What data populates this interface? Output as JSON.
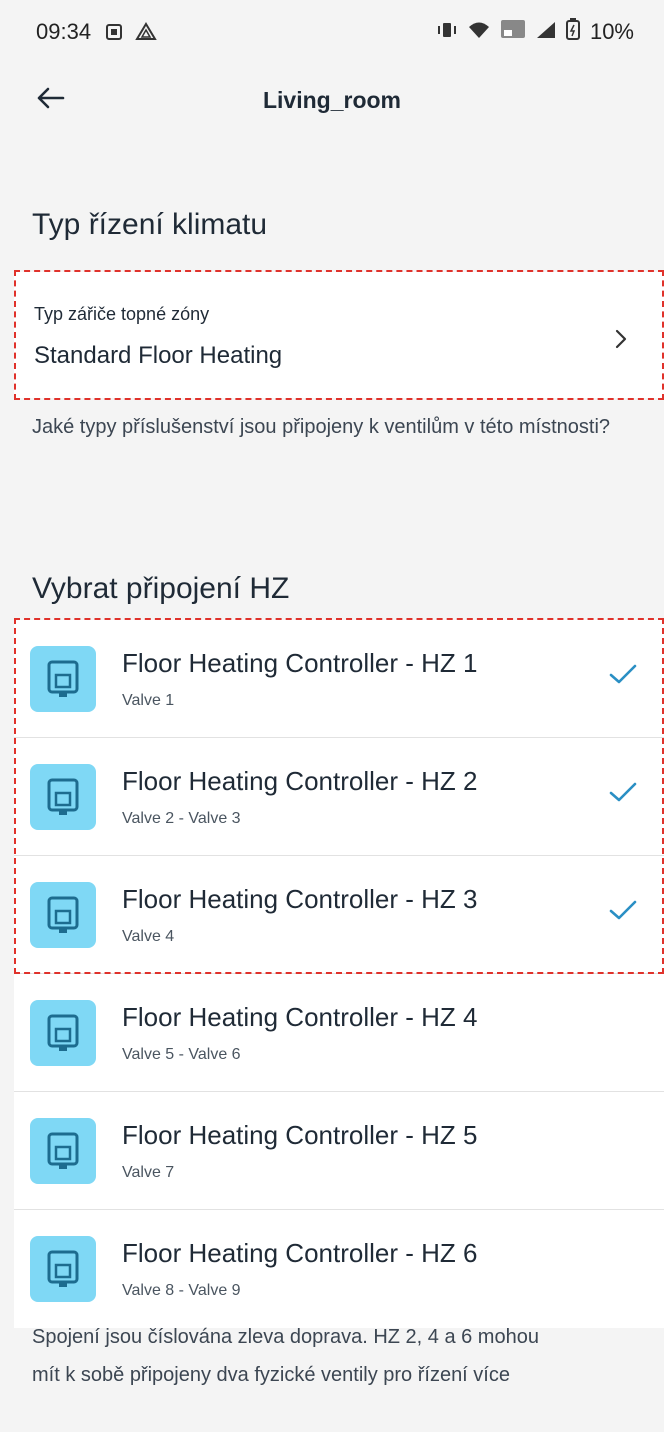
{
  "status_bar": {
    "time": "09:34",
    "battery": "10%",
    "left_icons": [
      "notification-icon",
      "drive-icon"
    ],
    "right_icons": [
      "vibrate-icon",
      "wifi-icon",
      "volte-icon",
      "signal-icon",
      "battery-icon"
    ]
  },
  "app_bar": {
    "title": "Living_room"
  },
  "climate": {
    "section_title": "Typ řízení klimatu",
    "zone_label": "Typ zářiče topné zóny",
    "zone_value": "Standard Floor Heating",
    "help_text": "Jaké typy příslušenství jsou připojeny k ventilům v této místnosti?"
  },
  "connections": {
    "section_title": "Vybrat připojení HZ",
    "items": [
      {
        "name": "Floor Heating Controller - HZ 1",
        "valves": "Valve 1",
        "selected": true
      },
      {
        "name": "Floor Heating Controller - HZ 2",
        "valves": "Valve 2 - Valve 3",
        "selected": true
      },
      {
        "name": "Floor Heating Controller - HZ 3",
        "valves": "Valve 4",
        "selected": true
      },
      {
        "name": "Floor Heating Controller - HZ 4",
        "valves": "Valve 5 - Valve 6",
        "selected": false
      },
      {
        "name": "Floor Heating Controller - HZ 5",
        "valves": "Valve 7",
        "selected": false
      },
      {
        "name": "Floor Heating Controller - HZ 6",
        "valves": "Valve 8 - Valve 9",
        "selected": false
      }
    ]
  },
  "footer": {
    "line1": "Spojení jsou číslována zleva doprava.  HZ 2, 4 a 6 mohou",
    "line2": "mít k sobě připojeny dva fyzické ventily pro řízení více"
  },
  "colors": {
    "background": "#f4f4f4",
    "accent": "#2a8fc4",
    "tile": "#7fd8f5",
    "highlight_dash": "#e0322b"
  }
}
